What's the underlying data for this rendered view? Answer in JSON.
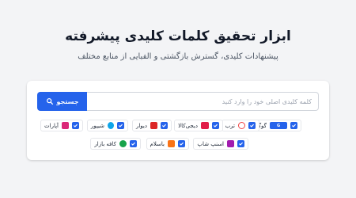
{
  "header": {
    "title": "ابزار تحقیق کلمات کلیدی پیشرفته",
    "subtitle": "پیشنهادات کلیدی، گسترش بازگشتی و الفبایی از منابع مختلف"
  },
  "search": {
    "placeholder": "کلمه کلیدی اصلی خود را وارد کنید",
    "value": "",
    "button_label": "جستجو"
  },
  "sources": [
    {
      "label": "گوگل",
      "checked": true,
      "logo_color": "#2563eb",
      "icon": "google-logo"
    },
    {
      "label": "ترب",
      "checked": true,
      "logo_color": "#ef4444",
      "icon": "torob-logo"
    },
    {
      "label": "دیجی‌کالا",
      "checked": true,
      "logo_color": "#e11d48",
      "icon": "digikala-logo"
    },
    {
      "label": "دیوار",
      "checked": true,
      "logo_color": "#dc2626",
      "icon": "divar-logo"
    },
    {
      "label": "شیپور",
      "checked": true,
      "logo_color": "#0ea5e9",
      "icon": "sheypoor-logo"
    },
    {
      "label": "آپارات",
      "checked": true,
      "logo_color": "#db2777",
      "icon": "aparat-logo"
    },
    {
      "label": "اسنپ شاپ",
      "checked": true,
      "logo_color": "#a21caf",
      "icon": "snappshop-logo"
    },
    {
      "label": "باسلام",
      "checked": true,
      "logo_color": "#f97316",
      "icon": "basalam-logo"
    },
    {
      "label": "کافه بازار",
      "checked": true,
      "logo_color": "#16a34a",
      "icon": "cafebazaar-logo"
    }
  ]
}
